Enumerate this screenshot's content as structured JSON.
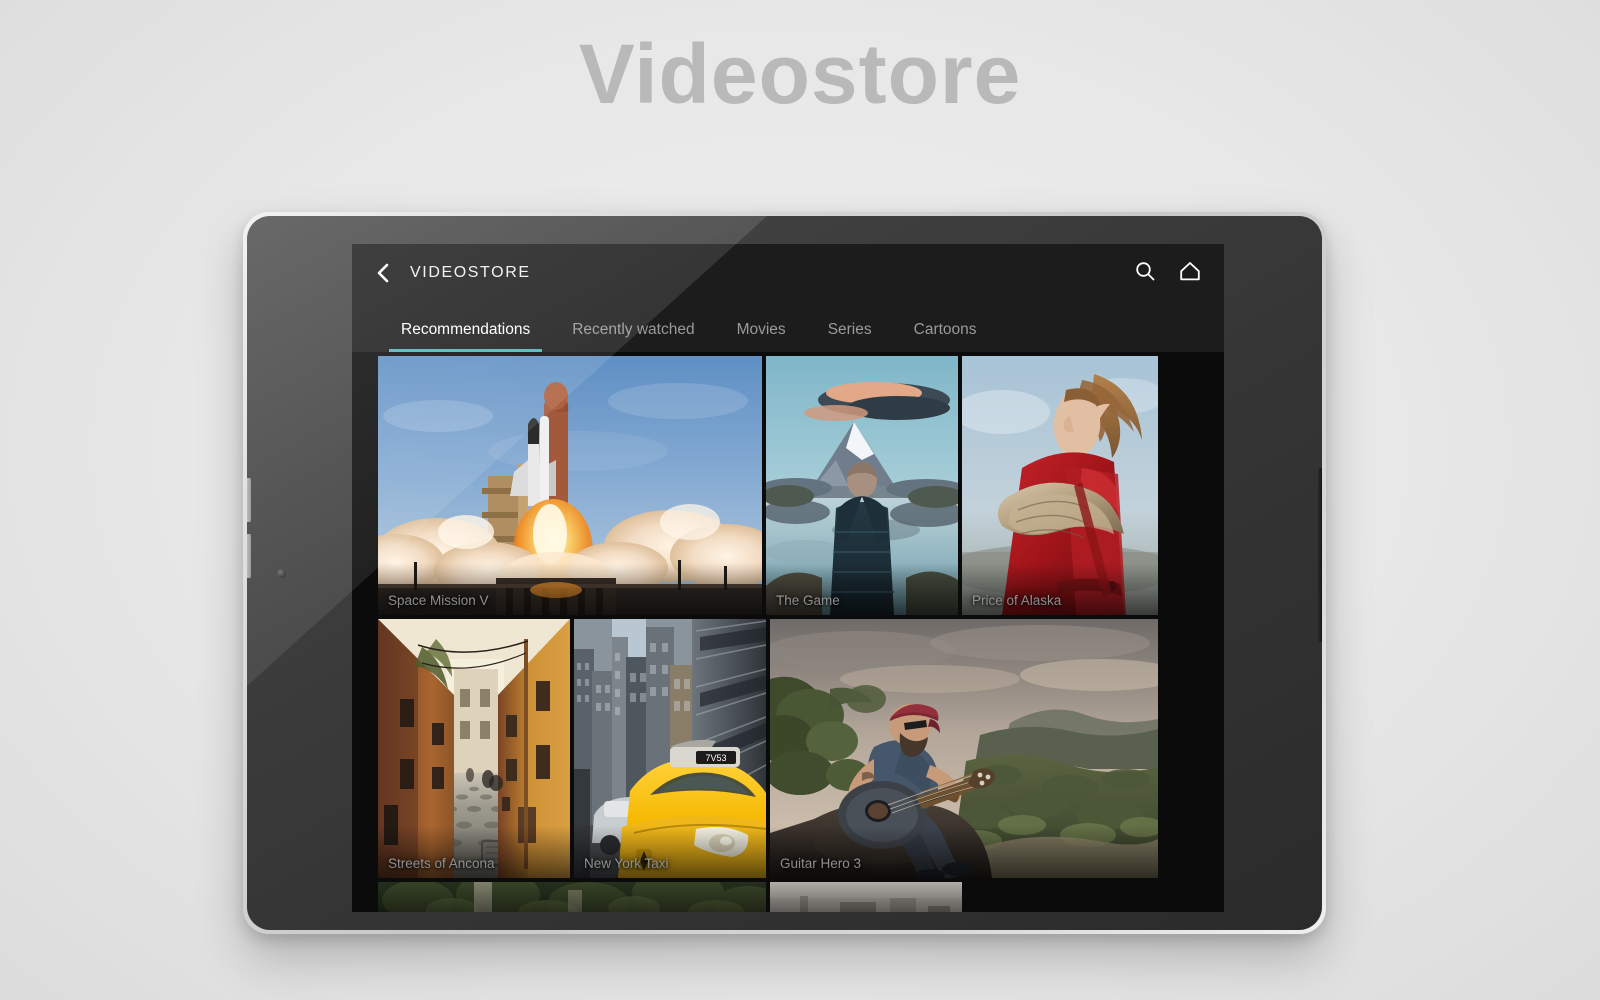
{
  "page": {
    "title": "Videostore",
    "background_color": "#e9e9e9",
    "title_color": "#b9b9b9"
  },
  "device": {
    "type": "tablet",
    "orientation": "landscape",
    "bezel_color": "#3a3a3a",
    "frame_color": "#d8d8d8"
  },
  "app": {
    "name": "VIDEOSTORE",
    "accent_color": "#4fb6bb",
    "background_color": "#0b0b0b",
    "topbar_color": "#1c1c1c",
    "back_icon": "chevron-left-icon",
    "actions": [
      {
        "name": "search-icon",
        "label": "Search"
      },
      {
        "name": "home-icon",
        "label": "Home"
      }
    ],
    "tabs": [
      {
        "label": "Recommendations",
        "active": true
      },
      {
        "label": "Recently watched",
        "active": false
      },
      {
        "label": "Movies",
        "active": false
      },
      {
        "label": "Series",
        "active": false
      },
      {
        "label": "Cartoons",
        "active": false
      }
    ]
  },
  "grid": {
    "rows": [
      {
        "tiles": [
          {
            "title": "Space Mission V",
            "size": "wide",
            "art": "shuttle-launch"
          },
          {
            "title": "The Game",
            "size": "narrow",
            "art": "mountain-lake"
          },
          {
            "title": "Price of Alaska",
            "size": "med",
            "art": "red-coat-woman"
          }
        ]
      },
      {
        "tiles": [
          {
            "title": "Streets of Ancona",
            "size": "tall",
            "art": "cobblestone-alley"
          },
          {
            "title": "New York Taxi",
            "size": "tall",
            "art": "yellow-taxi"
          },
          {
            "title": "Guitar Hero 3",
            "size": "big",
            "art": "guitarist-hill"
          }
        ]
      },
      {
        "tiles": [
          {
            "title": "",
            "size": "partial-wide",
            "art": "forest-path"
          },
          {
            "title": "",
            "size": "partial-narrow",
            "art": "hazy-city"
          }
        ]
      }
    ]
  }
}
